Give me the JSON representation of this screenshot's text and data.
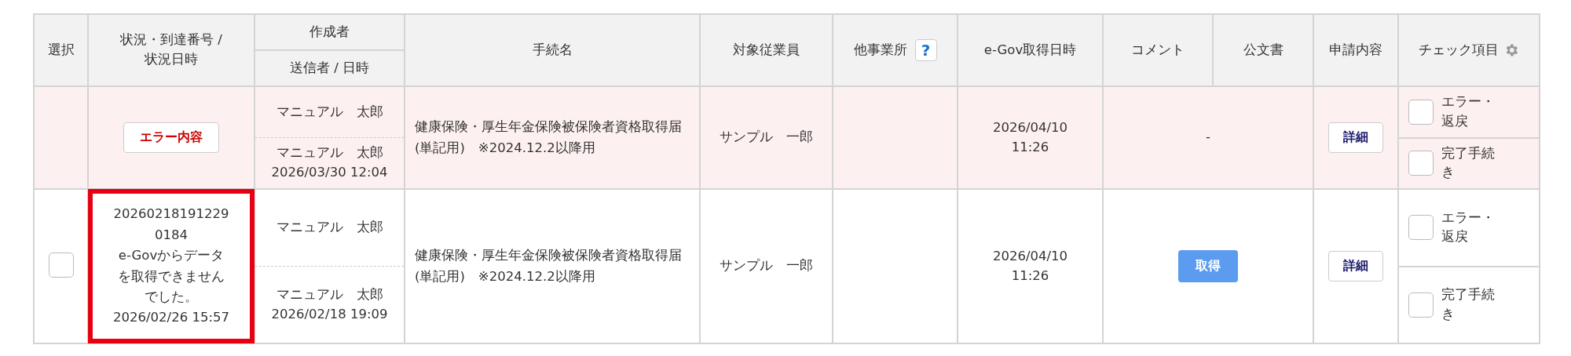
{
  "header": {
    "select": "選択",
    "status": "状況・到達番号 /\n状況日時",
    "creator": "作成者",
    "sender": "送信者 / 日時",
    "procedure": "手続名",
    "employee": "対象従業員",
    "other_office": "他事業所",
    "help_mark": "?",
    "egov_date": "e-Gov取得日時",
    "comment": "コメント",
    "official_doc": "公文書",
    "application": "申請内容",
    "check_items": "チェック項目"
  },
  "rows": [
    {
      "error": true,
      "selectable": false,
      "status": {
        "kind": "error_button",
        "label": "エラー内容",
        "highlighted": false
      },
      "creator": "マニュアル　太郎",
      "sender": "マニュアル　太郎",
      "sent_at": "2026/03/30 12:04",
      "procedure": "健康保険・厚生年金保険被保険者資格取得届 (単記用)　※2024.12.2以降用",
      "employee": "サンプル　一郎",
      "egov_date": "2026/04/10\n11:26",
      "document": {
        "kind": "dash",
        "text": "-"
      },
      "detail": "詳細",
      "checks": [
        {
          "label": "エラー・返戻",
          "checked": false
        },
        {
          "label": "完了手続き",
          "checked": false
        }
      ]
    },
    {
      "error": false,
      "selectable": true,
      "selected": false,
      "status": {
        "kind": "text",
        "number": "202602181912290184",
        "message": "e-Govからデータを取得できませんでした。",
        "date": "2026/02/26 15:57",
        "highlighted": true
      },
      "creator": "マニュアル　太郎",
      "sender": "マニュアル　太郎",
      "sent_at": "2026/02/18 19:09",
      "procedure": "健康保険・厚生年金保険被保険者資格取得届 (単記用)　※2024.12.2以降用",
      "employee": "サンプル　一郎",
      "egov_date": "2026/04/10\n11:26",
      "document": {
        "kind": "button",
        "text": "取得"
      },
      "detail": "詳細",
      "checks": [
        {
          "label": "エラー・返戻",
          "checked": false
        },
        {
          "label": "完了手続き",
          "checked": false
        }
      ]
    }
  ]
}
